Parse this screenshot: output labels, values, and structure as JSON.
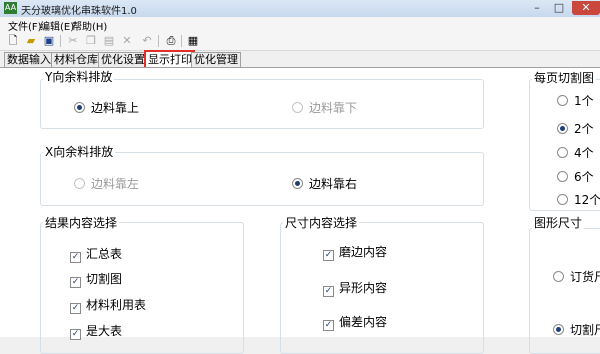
{
  "window": {
    "title": "天分玻璃优化串珠软件1.0"
  },
  "menu": [
    "文件(F)",
    "编辑(E)",
    "帮助(H)"
  ],
  "toolbar_icons": [
    "new-file-icon",
    "open-folder-icon",
    "save-icon",
    "cut-icon",
    "copy-icon",
    "paste-icon",
    "delete-icon",
    "undo-icon",
    "print-icon",
    "grid-icon"
  ],
  "tabs": [
    "数据输入",
    "材料仓库",
    "优化设置",
    "显示打印",
    "优化管理"
  ],
  "active_tab": "显示打印",
  "y_group": {
    "title": "Y向余料排放",
    "opt1": "边料靠上",
    "opt2": "边料靠下"
  },
  "x_group": {
    "title": "X向余料排放",
    "opt1": "边料靠左",
    "opt2": "边料靠右"
  },
  "result_group": {
    "title": "结果内容选择",
    "items": [
      "汇总表",
      "切割图",
      "材料利用表",
      "是大表"
    ]
  },
  "size_group": {
    "title": "尺寸内容选择",
    "items": [
      "磨边内容",
      "异形内容",
      "偏差内容"
    ]
  },
  "page_group": {
    "title": "每页切割图",
    "items": [
      "1个",
      "2个",
      "4个",
      "6个",
      "12个"
    ]
  },
  "shape_group": {
    "title": "图形尺寸",
    "opt1": "订货尺",
    "opt2": "切割尺"
  }
}
